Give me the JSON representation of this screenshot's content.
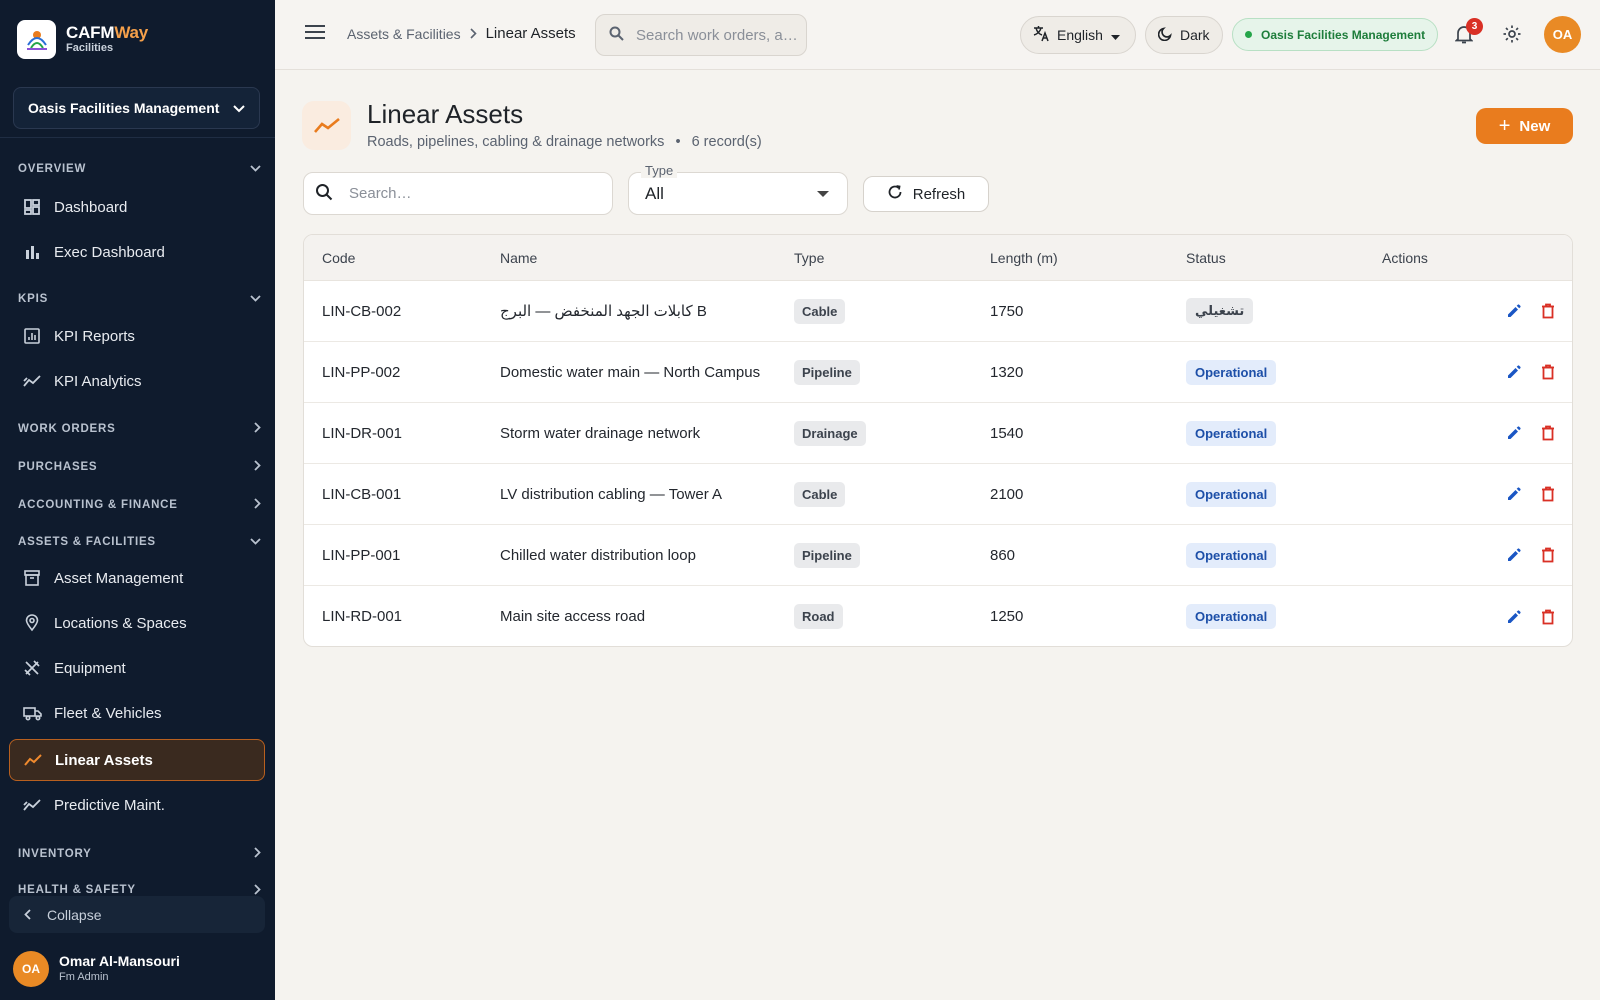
{
  "app": {
    "brand_name_a": "CAFM",
    "brand_name_b": "Way",
    "brand_sub": "Facilities",
    "org": "Oasis Facilities Management"
  },
  "sidebar": {
    "sections": [
      {
        "label": "OVERVIEW",
        "expanded": true
      },
      {
        "label": "KPIS",
        "expanded": true
      },
      {
        "label": "WORK ORDERS",
        "expanded": false
      },
      {
        "label": "PURCHASES",
        "expanded": false
      },
      {
        "label": "ACCOUNTING & FINANCE",
        "expanded": false
      },
      {
        "label": "ASSETS & FACILITIES",
        "expanded": true
      },
      {
        "label": "INVENTORY",
        "expanded": false
      },
      {
        "label": "HEALTH & SAFETY",
        "expanded": false
      }
    ],
    "items": [
      {
        "label": "Dashboard",
        "icon": "dashboard-icon"
      },
      {
        "label": "Exec Dashboard",
        "icon": "bar-chart-icon"
      },
      {
        "label": "KPI Reports",
        "icon": "report-icon"
      },
      {
        "label": "KPI Analytics",
        "icon": "analytics-icon"
      },
      {
        "label": "Asset Management",
        "icon": "archive-icon"
      },
      {
        "label": "Locations & Spaces",
        "icon": "location-pin-icon"
      },
      {
        "label": "Equipment",
        "icon": "tools-icon"
      },
      {
        "label": "Fleet & Vehicles",
        "icon": "truck-icon"
      },
      {
        "label": "Linear Assets",
        "icon": "trend-line-icon",
        "active": true
      },
      {
        "label": "Predictive Maint.",
        "icon": "analytics-icon"
      }
    ],
    "collapse_label": "Collapse",
    "user": {
      "initials": "OA",
      "name": "Omar Al-Mansouri",
      "role": "Fm Admin"
    }
  },
  "header": {
    "breadcrumb_parent": "Assets & Facilities",
    "breadcrumb_current": "Linear Assets",
    "search_placeholder": "Search work orders, a…",
    "language": "English",
    "theme": "Dark",
    "org_badge": "Oasis Facilities Management",
    "notification_count": "3",
    "avatar_initials": "OA"
  },
  "page": {
    "title": "Linear Assets",
    "subtitle": "Roads, pipelines, cabling & drainage networks",
    "record_count": "6 record(s)",
    "new_label": "New",
    "search_placeholder": "Search…",
    "type_label": "Type",
    "type_value": "All",
    "refresh_label": "Refresh"
  },
  "table": {
    "columns": [
      "Code",
      "Name",
      "Type",
      "Length (m)",
      "Status",
      "Actions"
    ],
    "rows": [
      {
        "code": "LIN-CB-002",
        "name": "كابلات الجهد المنخفض — البرج B",
        "type": "Cable",
        "length": "1750",
        "status": "تشغيلي"
      },
      {
        "code": "LIN-PP-002",
        "name": "Domestic water main — North Campus",
        "type": "Pipeline",
        "length": "1320",
        "status": "Operational"
      },
      {
        "code": "LIN-DR-001",
        "name": "Storm water drainage network",
        "type": "Drainage",
        "length": "1540",
        "status": "Operational"
      },
      {
        "code": "LIN-CB-001",
        "name": "LV distribution cabling — Tower A",
        "type": "Cable",
        "length": "2100",
        "status": "Operational"
      },
      {
        "code": "LIN-PP-001",
        "name": "Chilled water distribution loop",
        "type": "Pipeline",
        "length": "860",
        "status": "Operational"
      },
      {
        "code": "LIN-RD-001",
        "name": "Main site access road",
        "type": "Road",
        "length": "1250",
        "status": "Operational"
      }
    ]
  },
  "colors": {
    "sidebar_bg": "#0f1b2d",
    "accent": "#e97c1e",
    "status_blue": "#1d4fa8",
    "edit_icon": "#1a56c4",
    "delete_icon": "#d93025"
  }
}
